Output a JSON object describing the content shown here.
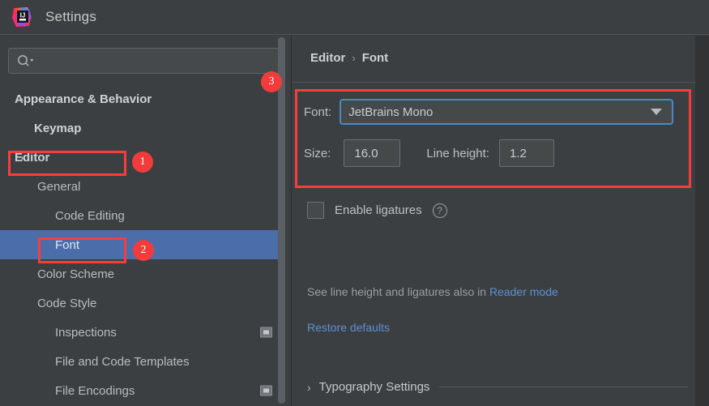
{
  "window": {
    "title": "Settings",
    "logo_icon": "intellij-idea-logo"
  },
  "sidebar": {
    "search": {
      "placeholder": "",
      "value": "",
      "icon": "search-icon"
    },
    "tree": [
      {
        "label": "Appearance & Behavior",
        "level": 0,
        "arrow": "right",
        "bold": true,
        "selected": false,
        "trailing_icon": ""
      },
      {
        "label": "Keymap",
        "level": 0,
        "arrow": "",
        "bold": true,
        "selected": false,
        "trailing_icon": ""
      },
      {
        "label": "Editor",
        "level": 0,
        "arrow": "down",
        "bold": true,
        "selected": false,
        "trailing_icon": ""
      },
      {
        "label": "General",
        "level": 1,
        "arrow": "right",
        "bold": false,
        "selected": false,
        "trailing_icon": ""
      },
      {
        "label": "Code Editing",
        "level": 1,
        "arrow": "",
        "bold": false,
        "selected": false,
        "trailing_icon": ""
      },
      {
        "label": "Font",
        "level": 1,
        "arrow": "",
        "bold": false,
        "selected": true,
        "trailing_icon": ""
      },
      {
        "label": "Color Scheme",
        "level": 1,
        "arrow": "right",
        "bold": false,
        "selected": false,
        "trailing_icon": ""
      },
      {
        "label": "Code Style",
        "level": 1,
        "arrow": "right",
        "bold": false,
        "selected": false,
        "trailing_icon": ""
      },
      {
        "label": "Inspections",
        "level": 1,
        "arrow": "",
        "bold": false,
        "selected": false,
        "trailing_icon": "project-scope-icon"
      },
      {
        "label": "File and Code Templates",
        "level": 1,
        "arrow": "",
        "bold": false,
        "selected": false,
        "trailing_icon": ""
      },
      {
        "label": "File Encodings",
        "level": 1,
        "arrow": "",
        "bold": false,
        "selected": false,
        "trailing_icon": "project-scope-icon"
      }
    ]
  },
  "panel": {
    "breadcrumb": {
      "parent": "Editor",
      "separator": "›",
      "current": "Font"
    },
    "font": {
      "label": "Font:",
      "value": "JetBrains Mono",
      "dropdown_icon": "chevron-down-icon"
    },
    "size": {
      "label": "Size:",
      "value": "16.0"
    },
    "line_height": {
      "label": "Line height:",
      "value": "1.2"
    },
    "ligatures": {
      "label": "Enable ligatures",
      "checked": false,
      "help_icon": "question-mark-icon",
      "help_glyph": "?"
    },
    "hint": {
      "text": "See line height and ligatures also in ",
      "link": "Reader mode"
    },
    "restore_defaults": "Restore defaults",
    "typography": {
      "label": "Typography Settings",
      "arrow": "›"
    }
  },
  "annotations": [
    {
      "id": "1",
      "target": "sidebar-editor"
    },
    {
      "id": "2",
      "target": "sidebar-font"
    },
    {
      "id": "3",
      "target": "panel-font-group"
    }
  ],
  "colors": {
    "background": "#3c3f41",
    "selection": "#4b6eab",
    "annotation_red": "#f23b3b",
    "link_blue": "#5b91d6",
    "focus_blue": "#4a88c7"
  }
}
